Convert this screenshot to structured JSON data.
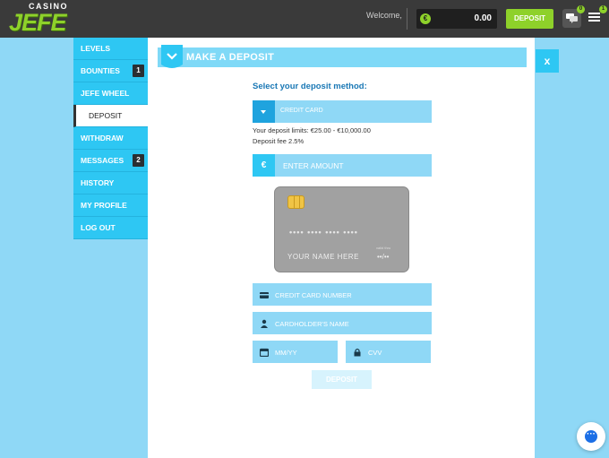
{
  "brand": {
    "logo_top": "CASINO",
    "logo_main": "JEFE"
  },
  "topbar": {
    "welcome": "Welcome,",
    "balance_currency": "€",
    "balance_amount": "0.00",
    "deposit_label": "DEPOSIT",
    "chat_badge": "0",
    "menu_badge": "1"
  },
  "sidebar": {
    "items": [
      {
        "label": "LEVELS"
      },
      {
        "label": "BOUNTIES",
        "count": "1"
      },
      {
        "label": "JEFE WHEEL"
      },
      {
        "label": "DEPOSIT",
        "active": true
      },
      {
        "label": "WITHDRAW"
      },
      {
        "label": "MESSAGES",
        "count": "2"
      },
      {
        "label": "HISTORY"
      },
      {
        "label": "MY PROFILE"
      },
      {
        "label": "LOG OUT"
      }
    ]
  },
  "deposit": {
    "title": "MAKE A DEPOSIT",
    "close_label": "x",
    "method_title": "Select your deposit method:",
    "method_selected": "CREDIT CARD",
    "limits": "Your deposit limits: €25.00 - €10,000.00",
    "fee": "Deposit fee 2.5%",
    "amount_currency": "€",
    "amount_placeholder": "ENTER AMOUNT",
    "card_preview": {
      "number": "•••• •••• •••• ••••",
      "name": "YOUR NAME HERE",
      "valid_label": "valid thru",
      "expiry": "••/••"
    },
    "card_number_placeholder": "CREDIT CARD NUMBER",
    "cardholder_placeholder": "CARDHOLDER'S NAME",
    "expiry_placeholder": "MM/YY",
    "cvv_placeholder": "CVV",
    "submit_label": "DEPOSIT"
  },
  "colors": {
    "accent_green": "#8ed12a",
    "accent_blue": "#2ec7f3",
    "topbar": "#3a3a3a"
  },
  "icons": [
    "chat-icon",
    "menu-icon",
    "chevron-down-icon",
    "euro-icon",
    "credit-card-icon",
    "user-icon",
    "calendar-icon",
    "lock-icon",
    "livechat-icon"
  ]
}
